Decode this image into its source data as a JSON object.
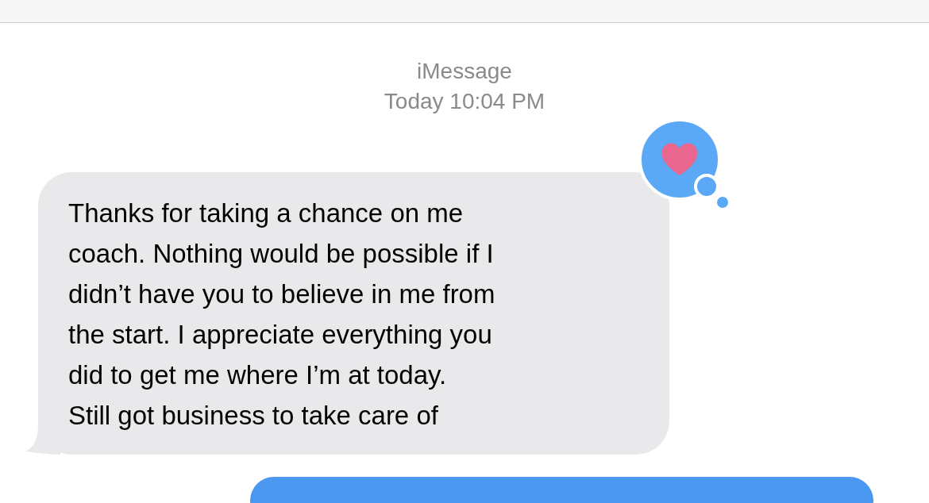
{
  "header": {
    "service": "iMessage",
    "timestamp": "Today 10:04 PM"
  },
  "messages": [
    {
      "kind": "incoming",
      "text": "Thanks for taking a chance on me\ncoach. Nothing would be possible if I\ndidn’t have you to believe in me from\nthe start. I appreciate everything you\ndid to get me where I’m at today.\nStill got business to take care of",
      "hearted": true
    },
    {
      "kind": "outgoing"
    }
  ]
}
